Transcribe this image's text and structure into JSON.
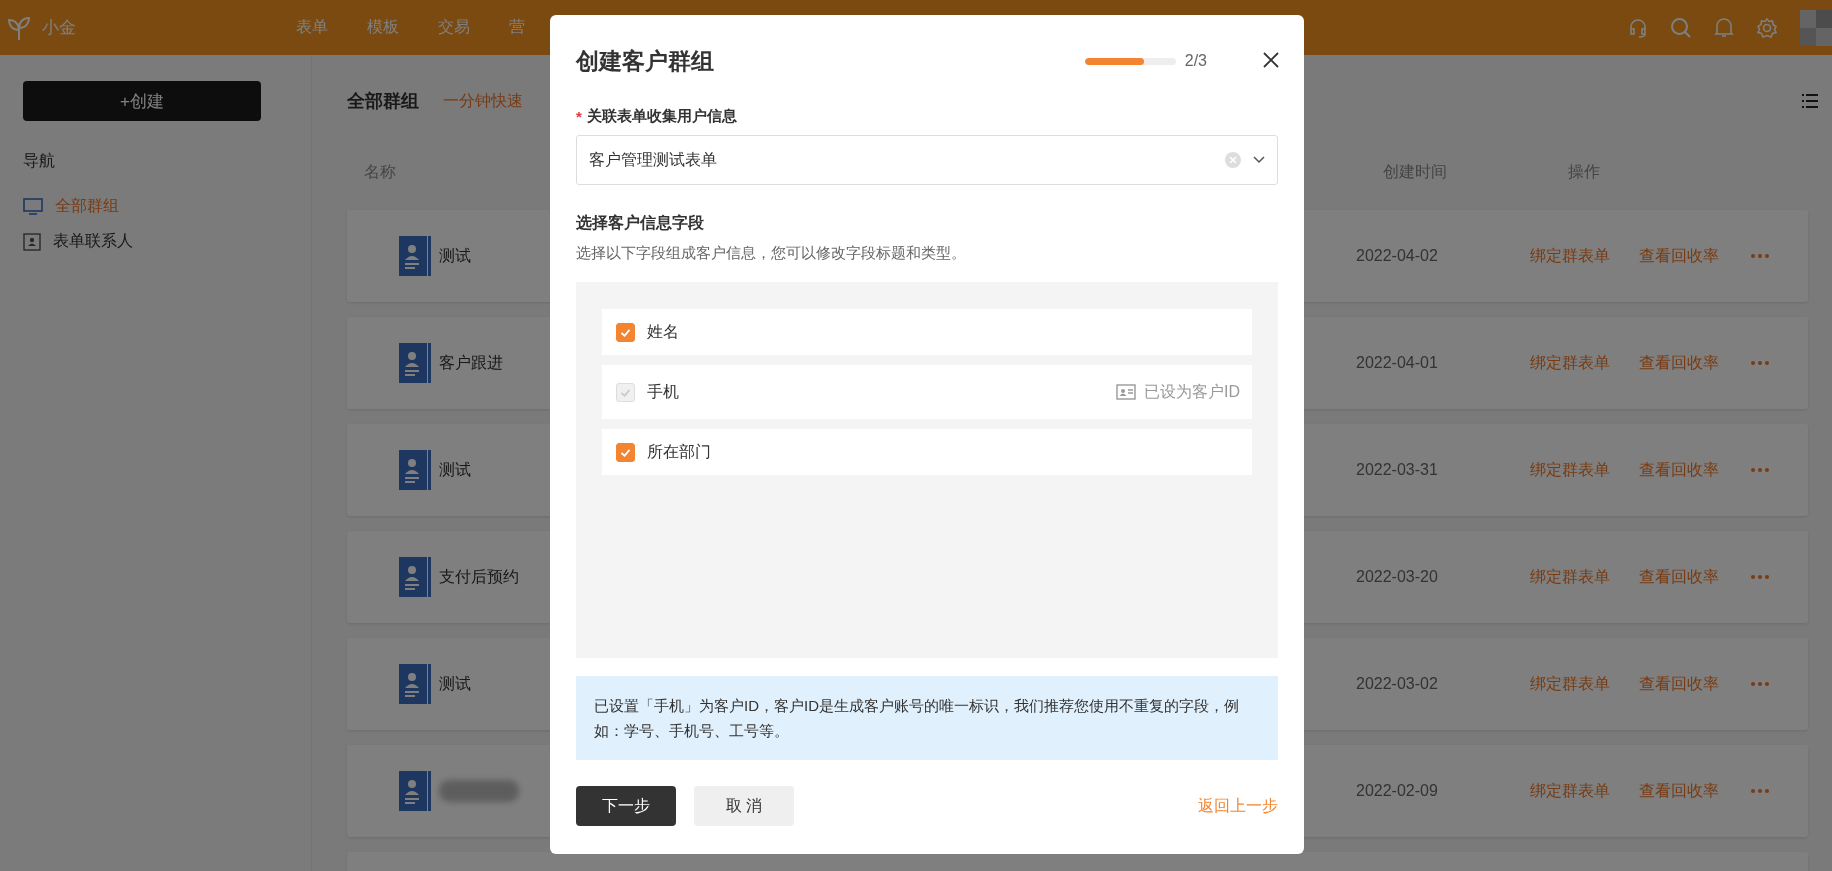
{
  "app_bar": {
    "brand": "小金",
    "nav": [
      {
        "label": "表单"
      },
      {
        "label": "模板"
      },
      {
        "label": "交易"
      },
      {
        "label": "营"
      }
    ]
  },
  "sidebar": {
    "create_button": "+创建",
    "nav_heading": "导航",
    "items": [
      {
        "label": "全部群组",
        "selected": true
      },
      {
        "label": "表单联系人",
        "selected": false
      }
    ]
  },
  "main": {
    "title": "全部群组",
    "link": "一分钟快速",
    "columns": [
      {
        "label": "名称"
      },
      {
        "label": "创建时间"
      },
      {
        "label": "操作"
      }
    ],
    "rows": [
      {
        "name": "测试",
        "created": "2022-04-02",
        "actions": [
          "绑定群表单",
          "查看回收率"
        ]
      },
      {
        "name": "客户跟进",
        "created": "2022-04-01",
        "actions": [
          "绑定群表单",
          "查看回收率"
        ]
      },
      {
        "name": "测试",
        "created": "2022-03-31",
        "actions": [
          "绑定群表单",
          "查看回收率"
        ]
      },
      {
        "name": "支付后预约",
        "created": "2022-03-20",
        "actions": [
          "绑定群表单",
          "查看回收率"
        ]
      },
      {
        "name": "测试",
        "created": "2022-03-02",
        "actions": [
          "绑定群表单",
          "查看回收率"
        ]
      },
      {
        "name_blurred": true,
        "created": "2022-02-09",
        "actions": [
          "绑定群表单",
          "查看回收率"
        ]
      }
    ]
  },
  "modal": {
    "title": "创建客户群组",
    "progress": {
      "level": 0.65,
      "label": "2/3"
    },
    "form_field": {
      "required_mark": "*",
      "label": "关联表单收集用户信息",
      "value": "客户管理测试表单"
    },
    "section": {
      "title": "选择客户信息字段",
      "description": "选择以下字段组成客户信息，您可以修改字段标题和类型。"
    },
    "fields": [
      {
        "label": "姓名",
        "checked": true,
        "disabled": false
      },
      {
        "label": "手机",
        "checked": true,
        "disabled": true,
        "tag": "已设为客户ID"
      },
      {
        "label": "所在部门",
        "checked": true,
        "disabled": false
      }
    ],
    "notice": "已设置「手机」为客户ID，客户ID是生成客户账号的唯一标识，我们推荐您使用不重复的字段，例如：学号、手机号、工号等。",
    "buttons": {
      "primary": "下一步",
      "secondary": "取 消",
      "back": "返回上一步"
    }
  }
}
